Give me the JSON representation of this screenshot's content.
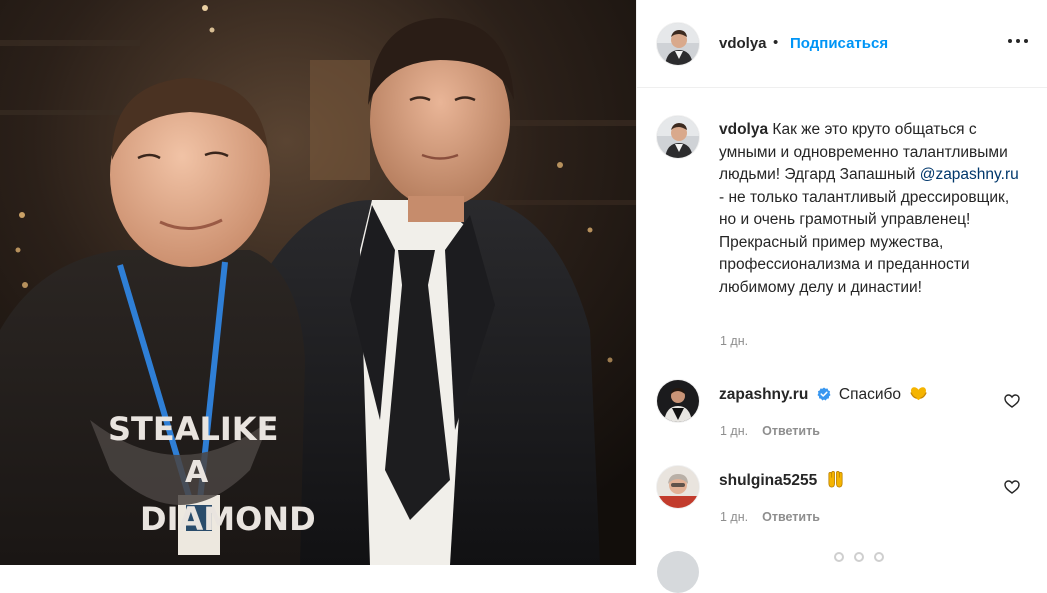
{
  "post": {
    "author": "vdolya",
    "separator": "•",
    "follow_label": "Подписаться",
    "more_icon": "more-horizontal-icon"
  },
  "caption": {
    "username": "vdolya",
    "text_before_mention": "Как же это круто общаться с умными и одновременно талантливыми людьми! Эдгард Запашный",
    "mention": "@zapashny.ru",
    "text_after_mention": "- не только талантливый дрессировщик, но и очень грамотный управленец! Прекрасный пример мужества, профессионализма и преданности любимому делу и династии!",
    "time": "1 дн."
  },
  "comments": [
    {
      "username": "zapashny.ru",
      "verified": true,
      "text": "Спасибо",
      "emoji": "yellow-heart-hands-emoji",
      "time": "1 дн.",
      "reply_label": "Ответить"
    },
    {
      "username": "shulgina5255",
      "verified": false,
      "text": "",
      "emoji": "raising-hands-emoji",
      "time": "1 дн.",
      "reply_label": "Ответить"
    }
  ],
  "colors": {
    "link_blue": "#0095f6",
    "mention_blue": "#00376b",
    "muted_gray": "#8e8e8e",
    "text": "#262626",
    "emoji_yellow": "#f5b400"
  },
  "photo": {
    "shirt_text_line1": "STEALIKE",
    "shirt_text_line2": "A",
    "shirt_text_line3": "DIAMOND"
  }
}
